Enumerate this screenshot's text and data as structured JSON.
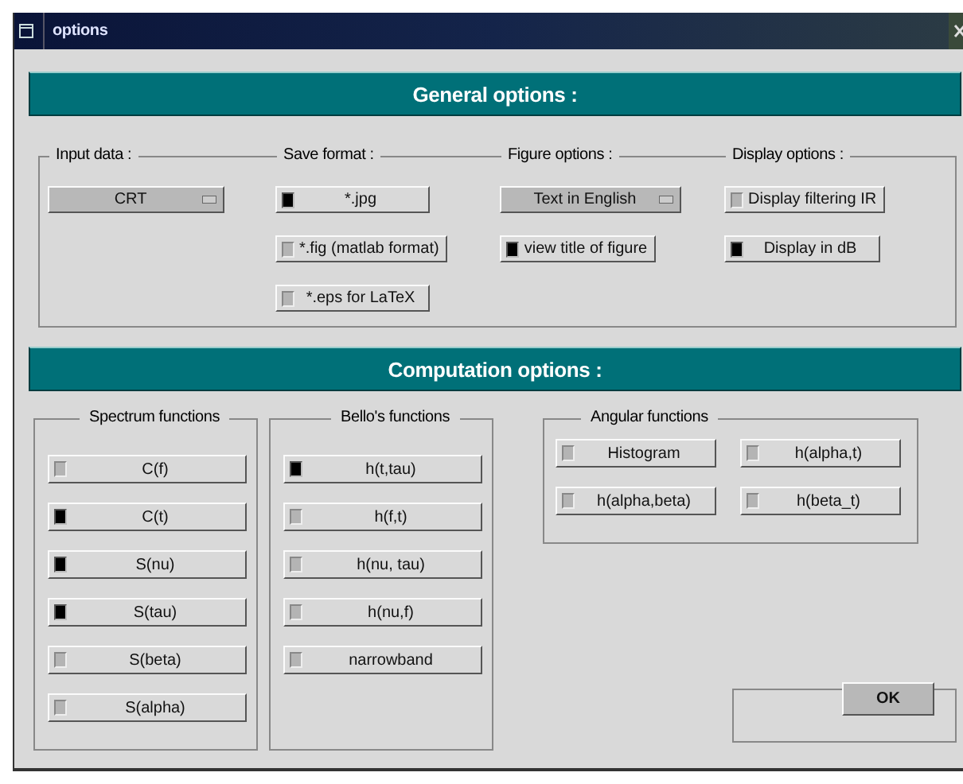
{
  "window": {
    "title": "options"
  },
  "general": {
    "header": "General options :",
    "groups": [
      {
        "label": "Input data :",
        "items": [
          {
            "kind": "dropdown",
            "value": "CRT"
          }
        ]
      },
      {
        "label": "Save format :",
        "items": [
          {
            "kind": "toggle",
            "label": "*.jpg",
            "checked": true
          },
          {
            "kind": "toggle",
            "label": "*.fig (matlab format)",
            "checked": false
          },
          {
            "kind": "toggle",
            "label": "*.eps for LaTeX",
            "checked": false
          }
        ]
      },
      {
        "label": "Figure options :",
        "items": [
          {
            "kind": "dropdown",
            "value": "Text in English"
          },
          {
            "kind": "toggle",
            "label": "view title of figure",
            "checked": true
          }
        ]
      },
      {
        "label": "Display options :",
        "items": [
          {
            "kind": "toggle",
            "label": "Display filtering IR",
            "checked": false
          },
          {
            "kind": "toggle",
            "label": "Display in dB",
            "checked": true
          }
        ]
      }
    ]
  },
  "computation": {
    "header": "Computation options :",
    "groups": [
      {
        "label": "Spectrum functions",
        "items": [
          {
            "kind": "toggle",
            "label": "C(f)",
            "checked": false
          },
          {
            "kind": "toggle",
            "label": "C(t)",
            "checked": true
          },
          {
            "kind": "toggle",
            "label": "S(nu)",
            "checked": true
          },
          {
            "kind": "toggle",
            "label": "S(tau)",
            "checked": true
          },
          {
            "kind": "toggle",
            "label": "S(beta)",
            "checked": false
          },
          {
            "kind": "toggle",
            "label": "S(alpha)",
            "checked": false
          }
        ]
      },
      {
        "label": "Bello's functions",
        "items": [
          {
            "kind": "toggle",
            "label": "h(t,tau)",
            "checked": true
          },
          {
            "kind": "toggle",
            "label": "h(f,t)",
            "checked": false
          },
          {
            "kind": "toggle",
            "label": "h(nu, tau)",
            "checked": false
          },
          {
            "kind": "toggle",
            "label": "h(nu,f)",
            "checked": false
          },
          {
            "kind": "toggle",
            "label": "narrowband",
            "checked": false
          }
        ]
      },
      {
        "label": "Angular functions",
        "items": [
          {
            "kind": "toggle",
            "label": "Histogram",
            "checked": false
          },
          {
            "kind": "toggle",
            "label": "h(alpha,t)",
            "checked": false
          },
          {
            "kind": "toggle",
            "label": "h(alpha,beta)",
            "checked": false
          },
          {
            "kind": "toggle",
            "label": "h(beta_t)",
            "checked": false
          }
        ]
      }
    ]
  },
  "buttons": [
    {
      "label": "OK"
    }
  ]
}
